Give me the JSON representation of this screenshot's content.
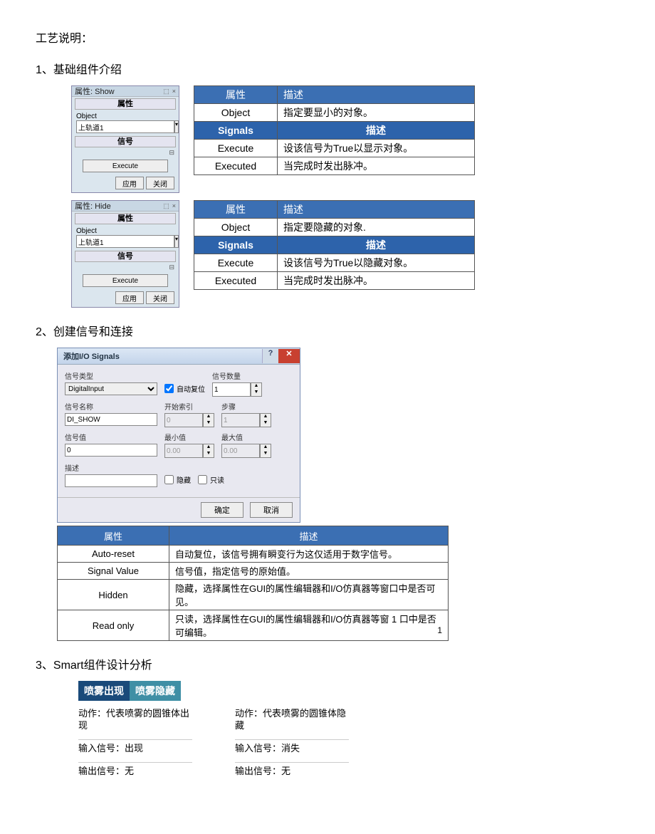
{
  "title": "工艺说明：",
  "sec1": "1、基础组件介绍",
  "panel_show": {
    "title": "属性: Show",
    "sub1": "属性",
    "obj_label": "Object",
    "obj_val": "上轨道1",
    "sub2": "信号",
    "exec": "Execute",
    "apply": "应用",
    "close": "关闭"
  },
  "table_show": {
    "h1a": "属性",
    "h1b": "描述",
    "r1a": "Object",
    "r1b": "指定要显小的对象。",
    "h2a": "Signals",
    "h2b": "描述",
    "r2a": "Execute",
    "r2b": "设该信号为True以显示对象。",
    "r3a": "Executed",
    "r3b": "当完成时发出脉冲。"
  },
  "panel_hide": {
    "title": "属性: Hide",
    "sub1": "属性",
    "obj_label": "Object",
    "obj_val": "上轨道1",
    "sub2": "信号",
    "exec": "Execute",
    "apply": "应用",
    "close": "关闭"
  },
  "table_hide": {
    "h1a": "属性",
    "h1b": "描述",
    "r1a": "Object",
    "r1b": "指定要隐藏的对象.",
    "h2a": "Signals",
    "h2b": "描述",
    "r2a": "Execute",
    "r2b": "设该信号为True以隐藏对象。",
    "r3a": "Executed",
    "r3b": "当完成时发出脉冲。"
  },
  "sec2": "2、创建信号和连接",
  "dialog": {
    "title": "添加I/O Signals",
    "type_lbl": "信号类型",
    "type_val": "DigitalInput",
    "auto_lbl": "自动复位",
    "count_lbl": "信号数量",
    "count_val": "1",
    "name_lbl": "信号名称",
    "name_val": "DI_SHOW",
    "start_lbl": "开始索引",
    "start_val": "0",
    "step_lbl": "步骤",
    "step_val": "1",
    "val_lbl": "信号值",
    "val_val": "0",
    "min_lbl": "最小值",
    "min_val": "0.00",
    "max_lbl": "最大值",
    "max_val": "0.00",
    "desc_lbl": "描述",
    "hidden_lbl": "隐藏",
    "readonly_lbl": "只读",
    "ok": "确定",
    "cancel": "取消"
  },
  "ptable": {
    "h1": "属性",
    "h2": "描述",
    "r1a": "Auto-reset",
    "r1b": "自动复位，该信号拥有瞬变行为这仅适用于数字信号。",
    "r2a": "Signal Value",
    "r2b": "信号值，指定信号的原始值。",
    "r3a": "Hidden",
    "r3b": "隐藏，选择属性在GUI的属性编辑器和I/O仿真器等窗口中是否可见。",
    "r4a": "Read only",
    "r4b": "只读，选择属性在GUI的属性编辑器和I/O仿真器等窗 1 口中是否可编辑。"
  },
  "pagenum": "1",
  "sec3": "3、Smart组件设计分析",
  "tabs": {
    "a": "喷雾出现",
    "b": "喷雾隐藏"
  },
  "colA": {
    "l1": "动作：代表喷雾的圆锥体出现",
    "l2": "输入信号：出现",
    "l3": "输出信号：无"
  },
  "colB": {
    "l1": "动作：代表喷雾的圆锥体隐藏",
    "l2": "输入信号：消失",
    "l3": "输出信号：无"
  }
}
